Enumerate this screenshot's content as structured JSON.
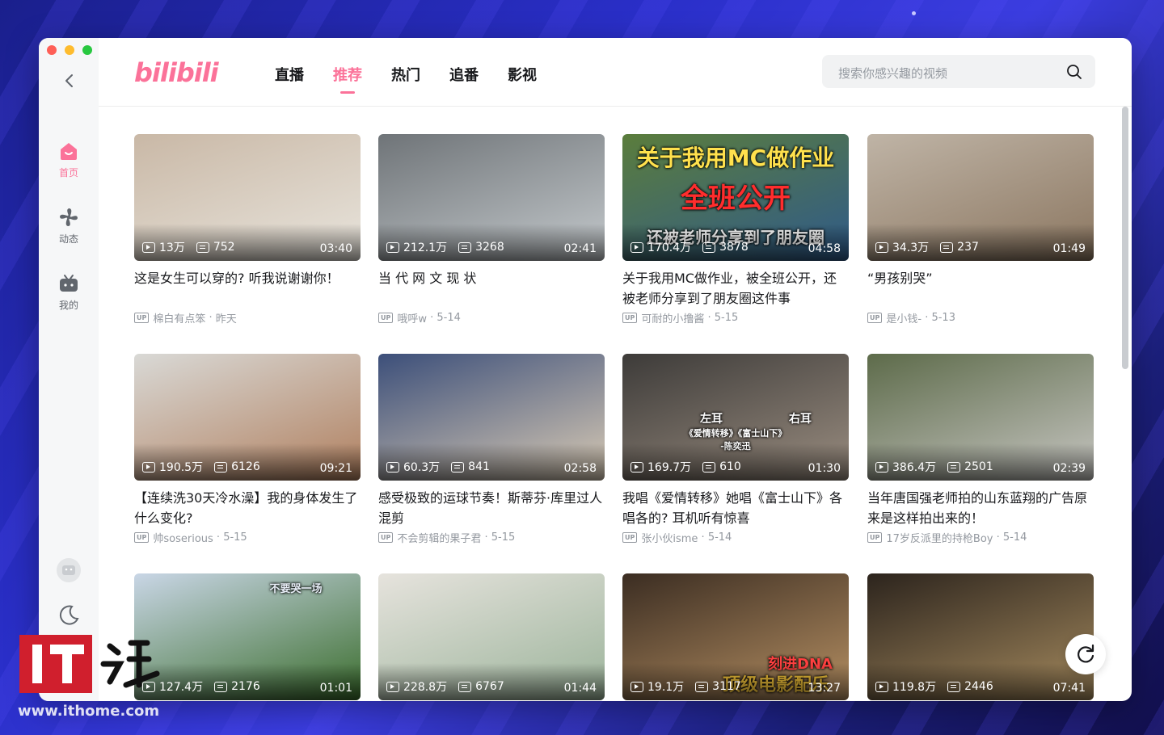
{
  "app": {
    "logo": "bilibili",
    "brand_color": "#fb7299"
  },
  "sidebar": {
    "items": [
      {
        "label": "首页",
        "icon": "home-icon",
        "active": true
      },
      {
        "label": "动态",
        "icon": "dynamic-icon",
        "active": false
      },
      {
        "label": "我的",
        "icon": "tv-icon",
        "active": false
      }
    ],
    "bottom_icons": [
      "avatar-icon",
      "moon-icon"
    ]
  },
  "nav": {
    "tabs": [
      "直播",
      "推荐",
      "热门",
      "追番",
      "影视"
    ],
    "active": "推荐"
  },
  "search": {
    "placeholder": "搜索你感兴趣的视频"
  },
  "videos": [
    {
      "views": "13万",
      "danmaku": "752",
      "duration": "03:40",
      "title": "这是女生可以穿的? 听我说谢谢你！",
      "uploader": "棉白有点笨",
      "date": "昨天",
      "palette": [
        "#c9b8a6",
        "#e8e4dc"
      ]
    },
    {
      "views": "212.1万",
      "danmaku": "3268",
      "duration": "02:41",
      "title": "当 代 网 文 现 状",
      "uploader": "哦呼w",
      "date": "5-14",
      "palette": [
        "#6f7478",
        "#c4c9cc"
      ]
    },
    {
      "views": "170.4万",
      "danmaku": "3878",
      "duration": "04:58",
      "title": "关于我用MC做作业，被全班公开，还被老师分享到了朋友圈这件事",
      "uploader": "可耐的小撸酱",
      "date": "5-15",
      "palette": [
        "#5b7d3c",
        "#2f5a8a"
      ],
      "overlay1": "关于我用MC做作业",
      "overlay2": "全班公开",
      "overlay3": "还被老师分享到了朋友圈"
    },
    {
      "views": "34.3万",
      "danmaku": "237",
      "duration": "01:49",
      "title": "“男孩别哭”",
      "uploader": "是小钱-",
      "date": "5-13",
      "palette": [
        "#bfb4a6",
        "#8b7660"
      ]
    },
    {
      "views": "190.5万",
      "danmaku": "6126",
      "duration": "09:21",
      "title": "【连续洗30天冷水澡】我的身体发生了什么变化?",
      "uploader": "帅soserious",
      "date": "5-15",
      "palette": [
        "#d9d9d6",
        "#b07f5e"
      ]
    },
    {
      "views": "60.3万",
      "danmaku": "841",
      "duration": "02:58",
      "title": "感受极致的运球节奏！斯蒂芬·库里过人混剪",
      "uploader": "不会剪辑的果子君",
      "date": "5-15",
      "palette": [
        "#3c4f7a",
        "#d9cbb5"
      ]
    },
    {
      "views": "169.7万",
      "danmaku": "610",
      "duration": "01:30",
      "title": "我唱《爱情转移》她唱《富士山下》各唱各的? 耳机听有惊喜",
      "uploader": "张小伙isme",
      "date": "5-14",
      "palette": [
        "#3d3b39",
        "#9a8d80"
      ],
      "overlay1": "左耳",
      "overlay2": "右耳",
      "overlay3": "《爱情转移》《富士山下》",
      "overlay4": "-陈奕迅"
    },
    {
      "views": "386.4万",
      "danmaku": "2501",
      "duration": "02:39",
      "title": "当年唐国强老师拍的山东蓝翔的广告原来是这样拍出来的！",
      "uploader": "17岁反派里的持枪Boy",
      "date": "5-14",
      "palette": [
        "#5d6b4a",
        "#c7c6c2"
      ]
    },
    {
      "views": "127.4万",
      "danmaku": "2176",
      "duration": "01:01",
      "title": "",
      "uploader": "",
      "date": "",
      "palette": [
        "#c9d6e6",
        "#3a6d2c"
      ],
      "overlay1": "不要哭一场"
    },
    {
      "views": "228.8万",
      "danmaku": "6767",
      "duration": "01:44",
      "title": "",
      "uploader": "",
      "date": "",
      "palette": [
        "#e6e3dd",
        "#9bb39a"
      ]
    },
    {
      "views": "19.1万",
      "danmaku": "3117",
      "duration": "13:27",
      "title": "",
      "uploader": "",
      "date": "",
      "palette": [
        "#3b2d22",
        "#b58f62"
      ],
      "overlay1": "刻进DNA",
      "overlay2": "顶级电影配乐"
    },
    {
      "views": "119.8万",
      "danmaku": "2446",
      "duration": "07:41",
      "title": "",
      "uploader": "",
      "date": "",
      "palette": [
        "#2c241d",
        "#a58a5e"
      ]
    }
  ],
  "watermark": {
    "logo": "IT之家",
    "url": "www.ithome.com"
  }
}
